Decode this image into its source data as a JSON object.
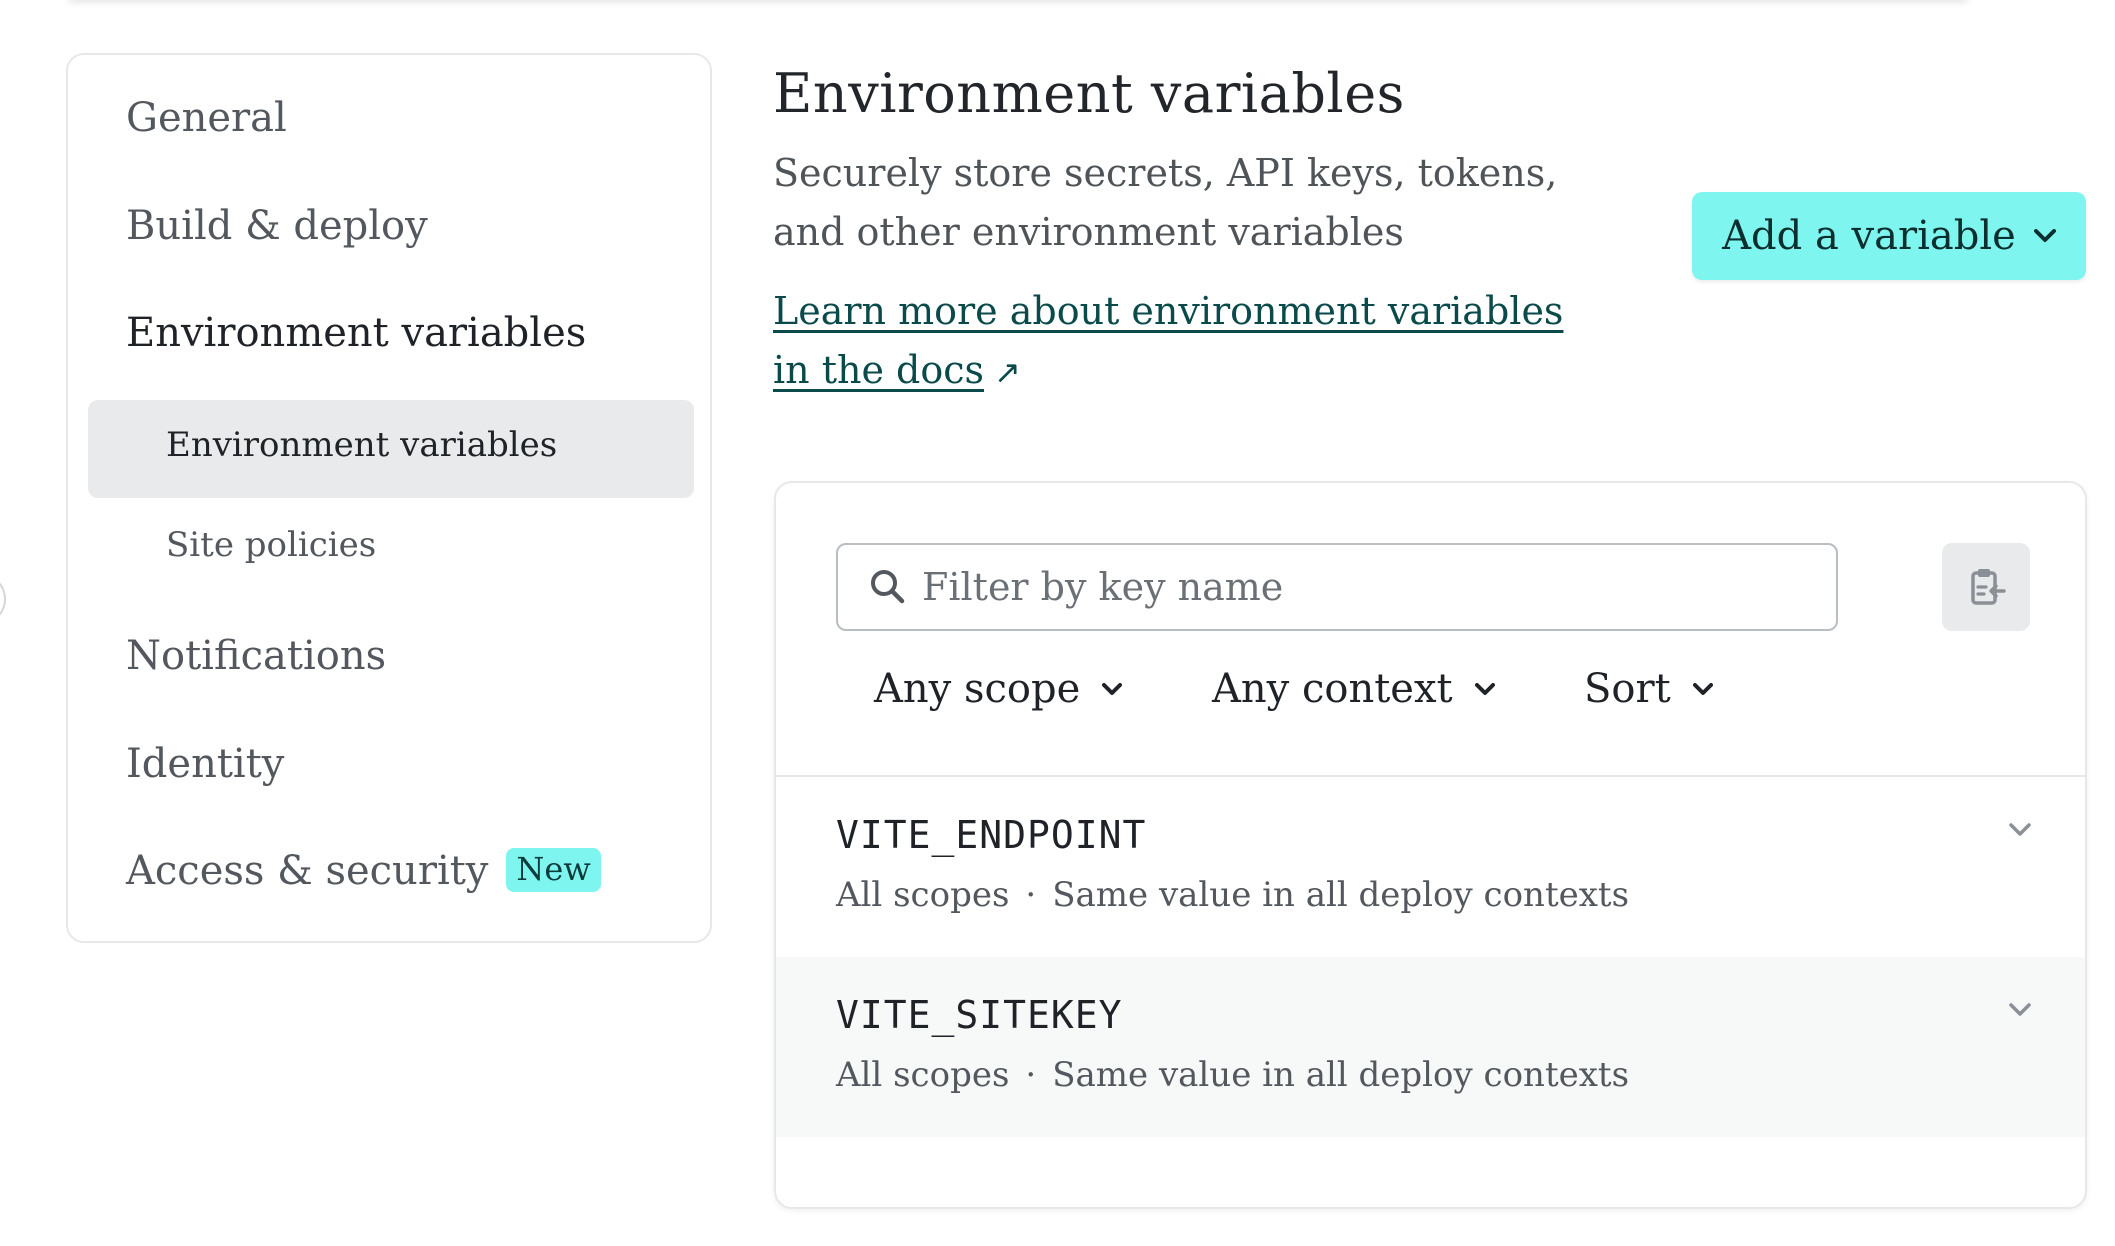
{
  "sidebar": {
    "items": [
      {
        "label": "General"
      },
      {
        "label": "Build & deploy"
      },
      {
        "label": "Environment variables"
      },
      {
        "label": "Notifications"
      },
      {
        "label": "Identity"
      },
      {
        "label": "Access & security",
        "badge": "New"
      }
    ],
    "subitems": [
      {
        "label": "Environment variables"
      },
      {
        "label": "Site policies"
      }
    ]
  },
  "header": {
    "title": "Environment variables",
    "description": "Securely store secrets, API keys, tokens, and other environment variables",
    "docs_link": "Learn more about environment variables in the docs",
    "docs_link_arrow": "↗",
    "add_button": "Add a variable"
  },
  "filters": {
    "search_placeholder": "Filter by key name",
    "scope": "Any scope",
    "context": "Any context",
    "sort": "Sort"
  },
  "variables": [
    {
      "key": "VITE_ENDPOINT",
      "scopes": "All scopes",
      "separator": "·",
      "contexts": "Same value in all deploy contexts"
    },
    {
      "key": "VITE_SITEKEY",
      "scopes": "All scopes",
      "separator": "·",
      "contexts": "Same value in all deploy contexts"
    }
  ],
  "colors": {
    "accent": "#7ff5f0",
    "link": "#0a4a4a",
    "selected_bg": "#e9eaeb"
  }
}
